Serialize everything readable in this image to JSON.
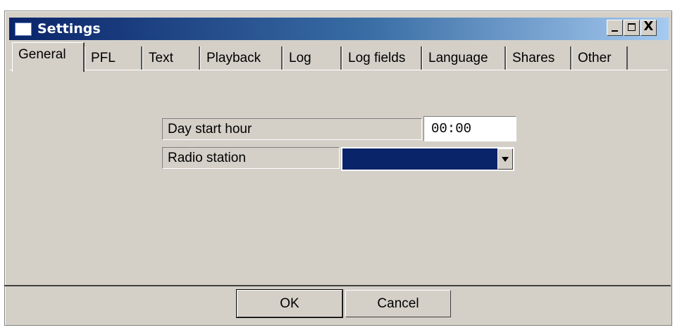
{
  "window": {
    "title": "Settings",
    "controls": [
      "minimize-icon",
      "maximize-icon",
      "close-icon"
    ],
    "close_glyph": "X"
  },
  "tabs": [
    {
      "label": "General",
      "active": true
    },
    {
      "label": "PFL",
      "active": false
    },
    {
      "label": "Text",
      "active": false
    },
    {
      "label": "Playback",
      "active": false
    },
    {
      "label": "Log",
      "active": false
    },
    {
      "label": "Log fields",
      "active": false
    },
    {
      "label": "Language",
      "active": false
    },
    {
      "label": "Shares",
      "active": false
    },
    {
      "label": "Other",
      "active": false
    }
  ],
  "general": {
    "day_start_hour_label": "Day start hour",
    "day_start_hour_value": "00:00",
    "radio_station_label": "Radio station",
    "radio_station_value": ""
  },
  "buttons": {
    "ok": "OK",
    "cancel": "Cancel"
  },
  "colors": {
    "titlebar_start": "#0a246a",
    "titlebar_end": "#a6caf0",
    "dialog_face": "#d4d0c8",
    "combo_selected": "#0a246a"
  }
}
